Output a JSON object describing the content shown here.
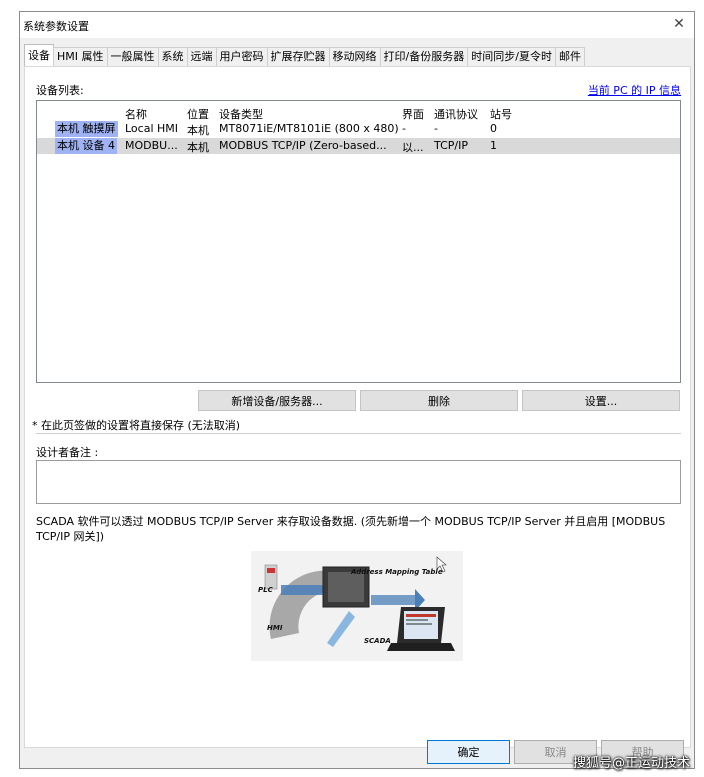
{
  "window": {
    "title": "系统参数设置",
    "close": "✕"
  },
  "tabs": [
    "设备",
    "HMI 属性",
    "一般属性",
    "系统",
    "远端",
    "用户密码",
    "扩展存贮器",
    "移动网络",
    "打印/备份服务器",
    "时间同步/夏令时",
    "邮件"
  ],
  "active_tab": "设备",
  "device_list": {
    "label": "设备列表:",
    "ip_link": "当前 PC 的 IP 信息",
    "columns": [
      "名称",
      "位置",
      "设备类型",
      "界面",
      "通讯协议",
      "站号"
    ],
    "rows": [
      {
        "tag": "本机 触摸屏",
        "name": "Local HMI",
        "location": "本机",
        "type": "MT8071iE/MT8101iE (800 x 480)",
        "interface": "-",
        "protocol": "-",
        "station": "0",
        "selected": false
      },
      {
        "tag": "本机 设备 4",
        "name": "MODBU...",
        "location": "本机",
        "type": "MODBUS TCP/IP (Zero-based...",
        "interface": "以...",
        "protocol": "TCP/IP",
        "station": "1",
        "selected": true
      }
    ]
  },
  "buttons": {
    "add": "新增设备/服务器...",
    "delete": "删除",
    "settings": "设置..."
  },
  "note": "* 在此页签做的设置将直接保存 (无法取消)",
  "designer_notes_label": "设计者备注 :",
  "designer_notes_value": "",
  "description": "SCADA 软件可以透过 MODBUS TCP/IP Server 来存取设备数据. (须先新增一个 MODBUS TCP/IP Server 并且启用 [MODBUS TCP/IP 网关])",
  "diagram": {
    "label_table": "Address Mapping Table",
    "label_plc": "PLC",
    "label_hmi": "HMI",
    "label_scada": "SCADA"
  },
  "footer": {
    "ok": "确定",
    "cancel": "取消",
    "help": "帮助"
  },
  "watermark": "搜狐号@正运动技术",
  "colors": {
    "tag_highlight": "#9fb2f4",
    "selected_row": "#d9d9d9",
    "link": "#0000ee",
    "ok_border": "#0078d7"
  }
}
